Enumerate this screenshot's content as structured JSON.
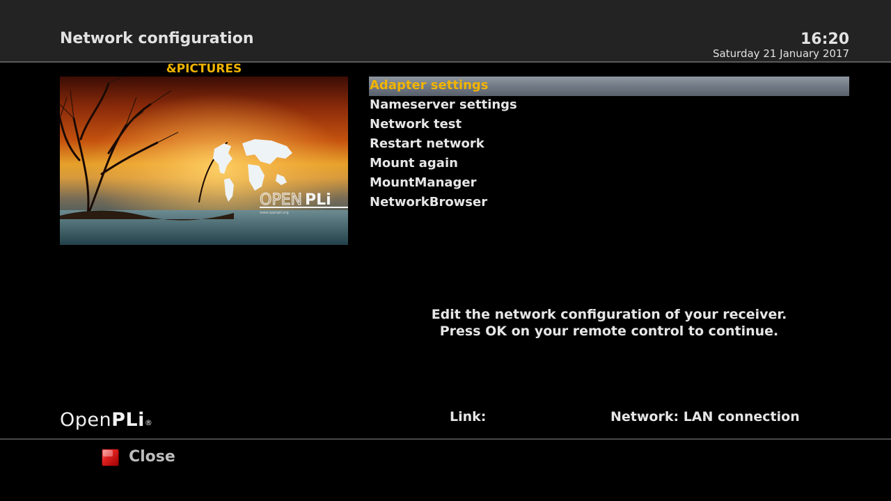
{
  "header": {
    "title": "Network configuration",
    "time": "16:20",
    "date": "Saturday 21 January 2017"
  },
  "picture_panel": {
    "label": "&PICTURES",
    "logo_text": "OPENPLi",
    "tagline": "www.openpli.org"
  },
  "menu": {
    "items": [
      {
        "label": "Adapter settings",
        "selected": true
      },
      {
        "label": "Nameserver settings",
        "selected": false
      },
      {
        "label": "Network test",
        "selected": false
      },
      {
        "label": "Restart network",
        "selected": false
      },
      {
        "label": "Mount again",
        "selected": false
      },
      {
        "label": "MountManager",
        "selected": false
      },
      {
        "label": "NetworkBrowser",
        "selected": false
      }
    ]
  },
  "description": {
    "line1": "Edit the network configuration of your receiver.",
    "line2": "Press OK on your remote control to continue."
  },
  "status": {
    "brand_open": "Open",
    "brand_pli": "PLi",
    "brand_reg": "®",
    "link_label": "Link:",
    "network_label": "Network: LAN connection"
  },
  "footer": {
    "close_label": "Close",
    "close_key_icon": "red-key-icon"
  },
  "colors": {
    "highlight_text": "#f0b400",
    "background": "#000000",
    "header_bg": "#232323",
    "red_key": "#e02020"
  }
}
